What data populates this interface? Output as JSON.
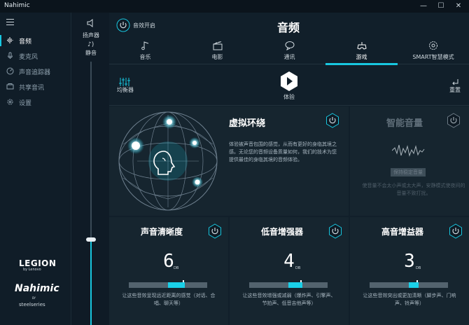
{
  "window": {
    "title": "Nahimic",
    "minimize": "—",
    "maximize": "☐",
    "close": "✕"
  },
  "sidebar": {
    "items": [
      {
        "label": "音频",
        "icon": "audio-wave-icon",
        "active": true
      },
      {
        "label": "麦克风",
        "icon": "microphone-icon",
        "active": false
      },
      {
        "label": "声音追踪器",
        "icon": "sound-tracker-icon",
        "active": false
      },
      {
        "label": "共享音讯",
        "icon": "share-audio-icon",
        "active": false
      },
      {
        "label": "设置",
        "icon": "gear-icon",
        "active": false
      }
    ],
    "legion": "LEGION",
    "legion_sub": "by Lenovo",
    "nahimic": "Nahimic",
    "nahimic_by": "BY",
    "steelseries": "steelseries"
  },
  "volume": {
    "speaker_label": "扬声器",
    "mute_label": "静音",
    "level": 0.32
  },
  "header": {
    "effects_toggle_label": "音效开启",
    "title": "音频"
  },
  "tabs": [
    {
      "label": "音乐",
      "icon": "music-note-icon",
      "active": false
    },
    {
      "label": "电影",
      "icon": "clapperboard-icon",
      "active": false
    },
    {
      "label": "通讯",
      "icon": "chat-bubble-icon",
      "active": false
    },
    {
      "label": "游戏",
      "icon": "gamepad-icon",
      "active": true
    },
    {
      "label": "SMART智慧模式",
      "icon": "smart-gear-icon",
      "active": false
    }
  ],
  "toolbar": {
    "equalizer_label": "均衡器",
    "experience_label": "体验",
    "reset_label": "重置"
  },
  "virtual_surround": {
    "title": "虚拟环绕",
    "description": "体验被声音包围的感觉，从而有更好的身临其境之感。无论您的音频设备质量如何，我们的技术为您提供最佳的身临其境的音频体验。"
  },
  "smart_volume": {
    "title": "智能音量",
    "button": "保持稳定音量",
    "description": "使音量不会太小声或太大声，安静模式使夜间的音量不致打扰。"
  },
  "cards": [
    {
      "title": "声音清晰度",
      "value": "6",
      "unit": "DB",
      "level": 0.6,
      "description": "让这些音效呈现远近距离的感觉（对话、合唱、聊天等）"
    },
    {
      "title": "低音增强器",
      "value": "4",
      "unit": "DB",
      "level": 0.4,
      "description": "让这些音效增强或减弱（爆炸声、引擎声、节拍声、低音吉他声等）"
    },
    {
      "title": "高音增益器",
      "value": "3",
      "unit": "DB",
      "level": 0.3,
      "description": "让这些音效突出或更加清晰（脚步声、门响声、铃声等）"
    }
  ],
  "colors": {
    "accent": "#18c7e0",
    "background": "#0e1a24",
    "panel": "#16252f"
  }
}
